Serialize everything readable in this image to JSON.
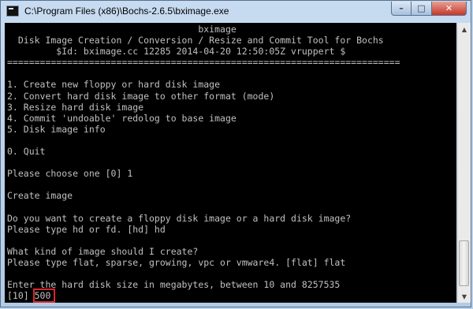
{
  "window": {
    "title": "C:\\Program Files (x86)\\Bochs-2.6.5\\bximage.exe",
    "controls": {
      "minimize": "–",
      "maximize": "□",
      "close": "✕"
    }
  },
  "console": {
    "lines": [
      "                                   bximage",
      "  Disk Image Creation / Conversion / Resize and Commit Tool for Bochs",
      "         $Id: bximage.cc 12285 2014-04-20 12:50:05Z vruppert $",
      "========================================================================",
      "",
      "1. Create new floppy or hard disk image",
      "2. Convert hard disk image to other format (mode)",
      "3. Resize hard disk image",
      "4. Commit 'undoable' redolog to base image",
      "5. Disk image info",
      "",
      "0. Quit",
      "",
      "Please choose one [0] 1",
      "",
      "Create image",
      "",
      "Do you want to create a floppy disk image or a hard disk image?",
      "Please type hd or fd. [hd] hd",
      "",
      "What kind of image should I create?",
      "Please type flat, sparse, growing, vpc or vmware4. [flat] flat",
      "",
      "Enter the hard disk size in megabytes, between 10 and 8257535"
    ],
    "prompt": "[10] ",
    "input_value": "500"
  },
  "colors": {
    "console_bg": "#000000",
    "console_fg": "#c0c0c0",
    "highlight": "#d9262a"
  }
}
